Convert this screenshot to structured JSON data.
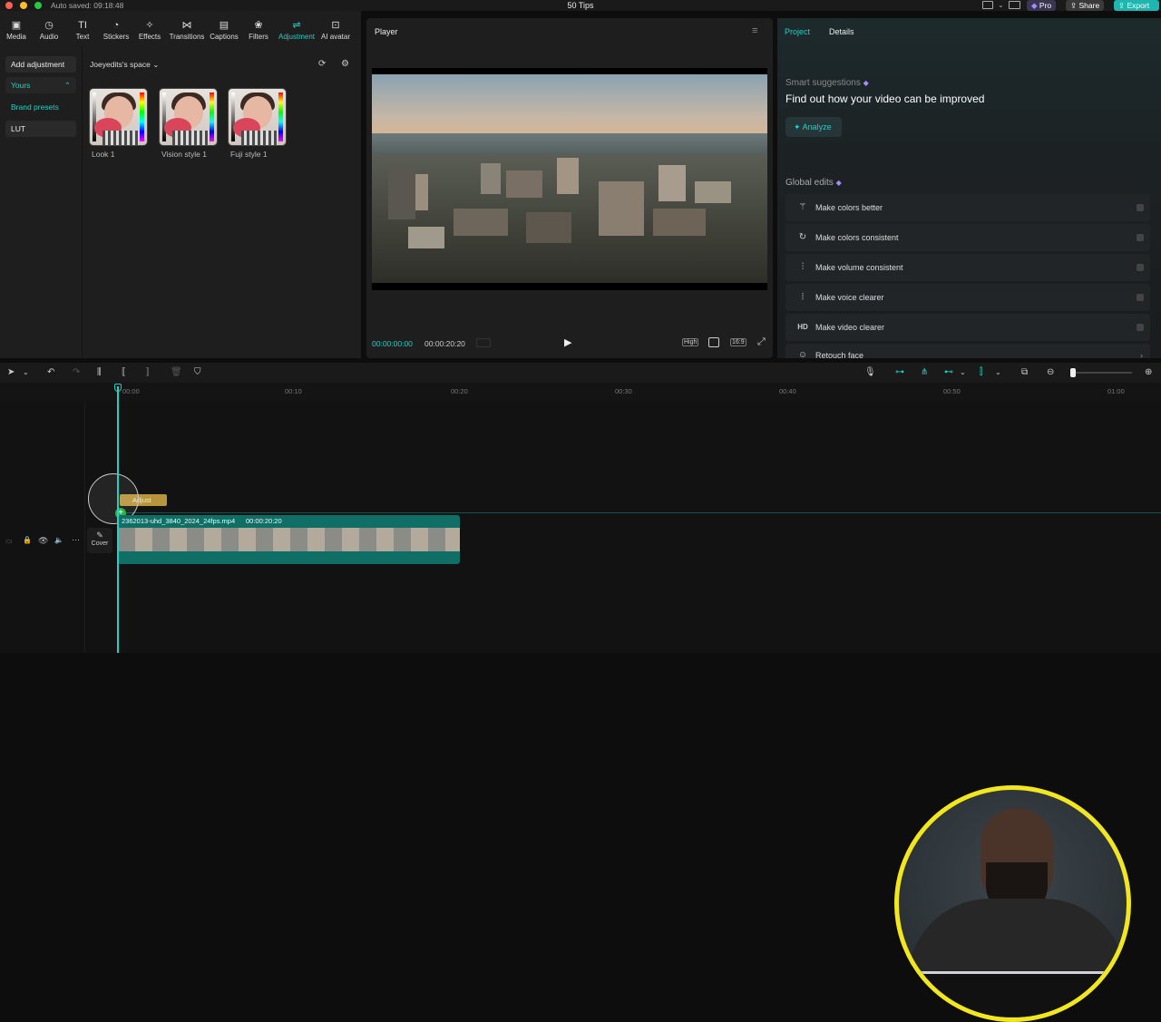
{
  "window": {
    "autosaved": "Auto saved: 09:18:48",
    "title": "50 Tips",
    "pro_label": "Pro",
    "share_label": "Share",
    "export_label": "Export"
  },
  "toolbar": {
    "tools": [
      {
        "label": "Media",
        "icon": "media-icon"
      },
      {
        "label": "Audio",
        "icon": "audio-icon"
      },
      {
        "label": "Text",
        "icon": "text-icon"
      },
      {
        "label": "Stickers",
        "icon": "stickers-icon"
      },
      {
        "label": "Effects",
        "icon": "effects-icon"
      },
      {
        "label": "Transitions",
        "icon": "transitions-icon"
      },
      {
        "label": "Captions",
        "icon": "captions-icon"
      },
      {
        "label": "Filters",
        "icon": "filters-icon"
      },
      {
        "label": "Adjustment",
        "icon": "adjustment-icon",
        "active": true
      },
      {
        "label": "AI avatar",
        "icon": "ai-avatar-icon"
      }
    ]
  },
  "left_panel": {
    "nav": [
      "Add adjustment",
      "Yours",
      "Brand presets",
      "LUT"
    ],
    "space_label": "Joeyedits's space",
    "presets": [
      "Look 1",
      "Vision style 1",
      "Fuji style 1"
    ]
  },
  "player": {
    "title": "Player",
    "current_time": "00:00:00:00",
    "total_time": "00:00:20:20",
    "quality": "High",
    "ratio": "16:9"
  },
  "right_panel": {
    "tabs": [
      "Project",
      "Details"
    ],
    "smart_suggestions_label": "Smart suggestions",
    "headline": "Find out how your video can be improved",
    "analyze_label": "Analyze",
    "global_edits_label": "Global edits",
    "edits": [
      {
        "label": "Make colors better",
        "icon": "magic-wand-icon"
      },
      {
        "label": "Make colors consistent",
        "icon": "color-match-icon"
      },
      {
        "label": "Make volume consistent",
        "icon": "sliders-icon"
      },
      {
        "label": "Make voice clearer",
        "icon": "waveform-icon"
      },
      {
        "label": "Make video clearer",
        "icon": "hd-icon",
        "icon_text": "HD"
      },
      {
        "label": "Retouch face",
        "icon": "face-icon"
      }
    ]
  },
  "timeline": {
    "ticks": [
      "00:00",
      "00:10",
      "00:20",
      "00:30",
      "00:40",
      "00:50",
      "01:00"
    ],
    "clip_name": "2362013-uhd_3840_2024_24fps.mp4",
    "clip_duration": "00:00:20:20",
    "adjust_label": "Adjust",
    "cover_label": "Cover"
  },
  "colors": {
    "accent": "#1fd1c6",
    "export_bg": "#1fb6b0",
    "adjust_clip": "#b8953c",
    "webcam_border": "#f2e71e"
  }
}
